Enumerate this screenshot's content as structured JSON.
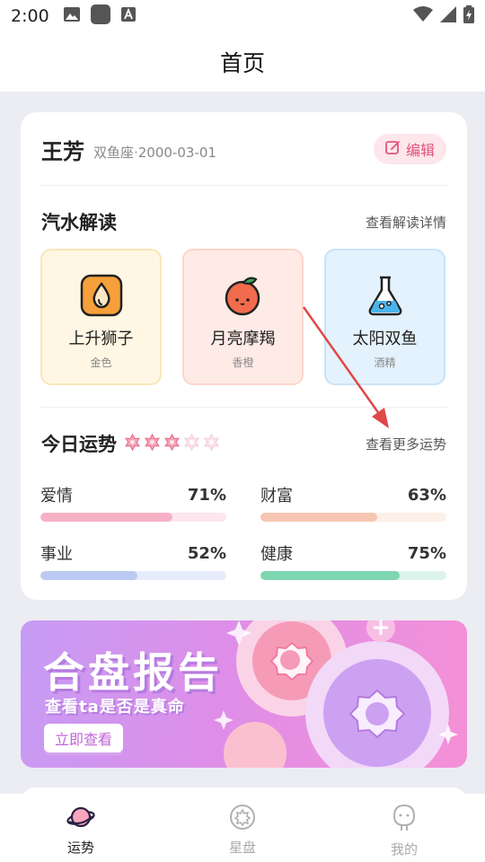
{
  "status_bar": {
    "time": "2:00"
  },
  "header": {
    "title": "首页"
  },
  "profile": {
    "name": "王芳",
    "meta": "双鱼座·2000-03-01",
    "edit_label": "编辑"
  },
  "qishui": {
    "title": "汽水解读",
    "link": "查看解读详情",
    "cards": [
      {
        "name": "上升狮子",
        "sub": "金色",
        "icon": "drop-icon",
        "bg": "#fff7e3",
        "border": "#fbe6b8"
      },
      {
        "name": "月亮摩羯",
        "sub": "香橙",
        "icon": "orange-icon",
        "bg": "#ffebe5",
        "border": "#fbd6cb"
      },
      {
        "name": "太阳双鱼",
        "sub": "酒精",
        "icon": "flask-icon",
        "bg": "#e3f2fd",
        "border": "#c9e3f7"
      }
    ]
  },
  "fortune": {
    "title": "今日运势",
    "link": "查看更多运势",
    "stars": 3,
    "stars_total": 5,
    "stats": [
      {
        "label": "爱情",
        "value": "71%",
        "level": 0.71,
        "fill": "#f7b1c6",
        "track": "#fde6ee"
      },
      {
        "label": "财富",
        "value": "63%",
        "level": 0.63,
        "fill": "#f6c6b2",
        "track": "#fdf0e8"
      },
      {
        "label": "事业",
        "value": "52%",
        "level": 0.52,
        "fill": "#bcc9f2",
        "track": "#e6ecfb"
      },
      {
        "label": "健康",
        "value": "75%",
        "level": 0.75,
        "fill": "#7dd6b0",
        "track": "#dcf3ea"
      }
    ]
  },
  "banner": {
    "title": "合盘报告",
    "subtitle": "查看ta是否是真命",
    "button": "立即查看"
  },
  "tabs": [
    {
      "label": "运势",
      "icon": "planet-icon",
      "active": true
    },
    {
      "label": "星盘",
      "icon": "astro-wheel-icon",
      "active": false
    },
    {
      "label": "我的",
      "icon": "person-icon",
      "active": false
    }
  ],
  "colors": {
    "accent": "#e0547a",
    "tab_active": "#222222",
    "tab_inactive": "#aaaaaa"
  }
}
